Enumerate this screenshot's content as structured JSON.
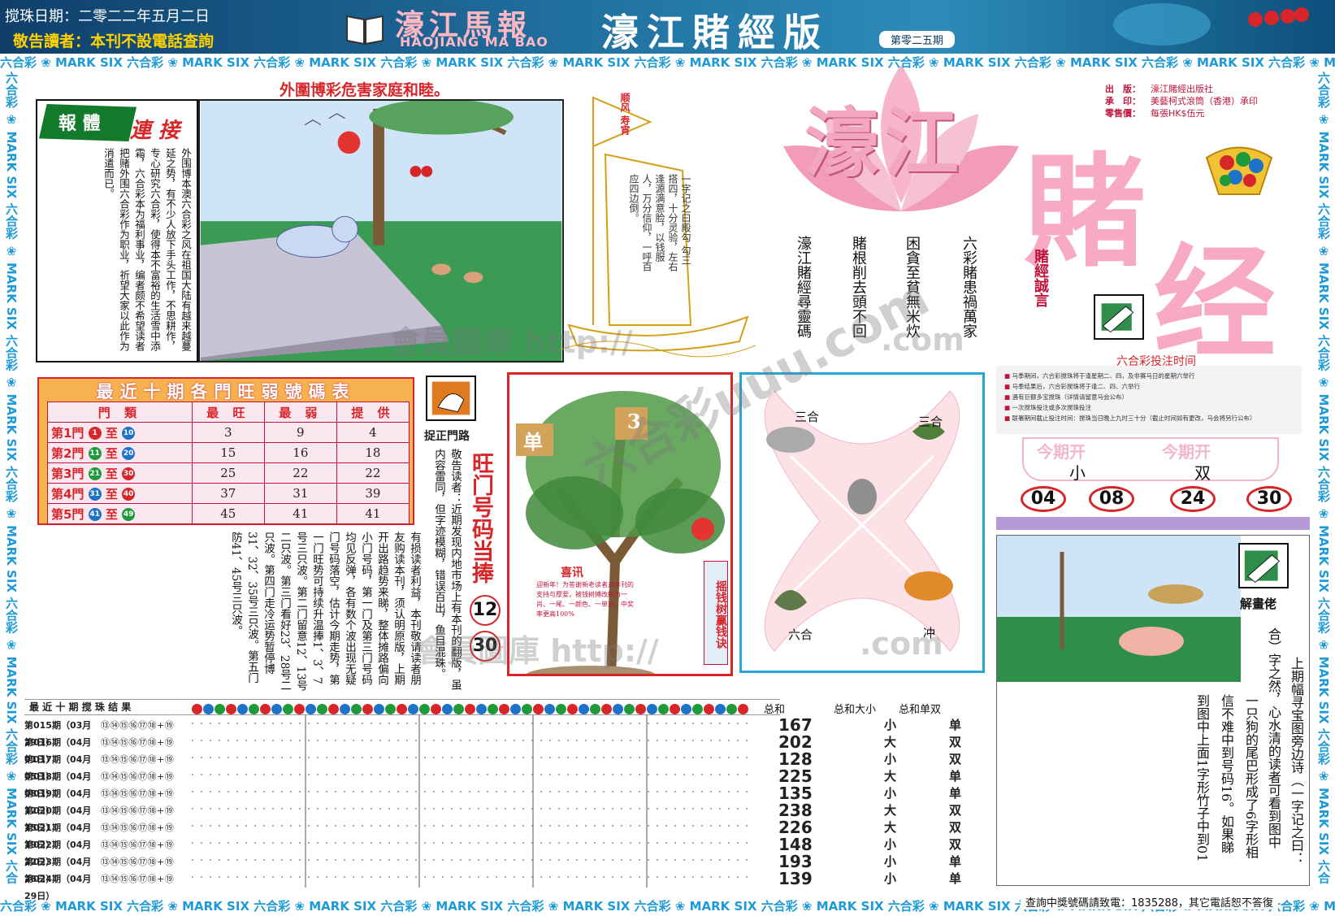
{
  "header": {
    "date": "搅珠日期：二零二二年五月二日",
    "notice": "敬告讀者：本刊不設電話查詢",
    "logo_cn": "濠江馬報",
    "logo_en": "HAOJIANG MA BAO",
    "edition": "濠江賭經版",
    "issue": "第零二五期"
  },
  "ribbon_text": "六合彩 ❀ MARK SIX 六合彩 ❀ MARK SIX 六合彩 ❀ MARK SIX 六合彩 ❀ MARK SIX 六合彩 ❀ MARK SIX 六合彩 ❀ MARK SIX 六合彩 ❀ MARK SIX 六合彩 ❀ MARK SIX 六合彩 ❀ MARK SIX 六合彩 ❀ MARK SIX 六合彩 ❀ MARK SIX 六合彩 ❀ MARK SIX",
  "article": {
    "headline": "外圍博彩危害家庭和睦。",
    "badge": "報 體",
    "badge2": "連 接",
    "body": "外围博本澳六合彩之风在祖国大陆有越来越蔓延之势，有不少人放下手头工作，不思耕作，专心研究六合彩，使得本不富裕的生活雪中添霜，六合彩本为福利事业，编者颇不希望读者把赌外围六合彩作为职业，祈望大家以此作为消遣而已。"
  },
  "boat": {
    "flag": "顺风 寿宵",
    "text": "一字记之曰殿勾 勾三搭四，十分灵验，左右逢源满意脸，以钱服人，万分信仰，一呼百应四边倒。"
  },
  "poems": [
    "六彩賭患禍萬家",
    "困貪至貧無米炊",
    "賭根削去頭不回",
    "濠江賭經尋靈碼"
  ],
  "masthead": {
    "line1": "濠江",
    "line2": "賭",
    "line3": "经",
    "motto": "賭經誠言"
  },
  "publisher": [
    {
      "k": "出　版：",
      "v": "濠江賭經出版社"
    },
    {
      "k": "承　印：",
      "v": "美藝柯式滾筒（香港）承印"
    },
    {
      "k": "零售價：",
      "v": "每張HK$伍元"
    }
  ],
  "bet_time": {
    "title": "六合彩投注时间",
    "lines": [
      "马季期间，六合彩搅珠将于逢星期二、四，及非赛马日的星期六举行",
      "马季结果后，六合彩搅珠将于逢二、四、六举行",
      "遇有巨额多宝搅珠（详情请留意马会公布）",
      "一次搅珠投注或多次搅珠投注",
      "联署期间截止投注时间：搅珠当日晚上九时三十分（截止时间如有更改，马会将另行公布）"
    ]
  },
  "this_period": {
    "label": "今期开",
    "values": [
      "小",
      "双"
    ],
    "numbers": [
      "04",
      "08",
      "24",
      "30"
    ]
  },
  "gate_table": {
    "title": "最近十期各門旺弱號碼表",
    "headers": [
      "門 類",
      "最 旺",
      "最 弱",
      "提 供"
    ],
    "rows": [
      {
        "gate": "第1門",
        "from": "1",
        "to": "10",
        "strong": "3",
        "weak": "9",
        "offer": "4",
        "c1": "#d7262a",
        "c2": "#1e73c8"
      },
      {
        "gate": "第2門",
        "from": "11",
        "to": "20",
        "strong": "15",
        "weak": "16",
        "offer": "18",
        "c1": "#1f9a3a",
        "c2": "#1e73c8"
      },
      {
        "gate": "第3門",
        "from": "21",
        "to": "30",
        "strong": "25",
        "weak": "22",
        "offer": "22",
        "c1": "#1f9a3a",
        "c2": "#d7262a"
      },
      {
        "gate": "第4門",
        "from": "31",
        "to": "40",
        "strong": "37",
        "weak": "31",
        "offer": "39",
        "c1": "#1e73c8",
        "c2": "#d7262a"
      },
      {
        "gate": "第5門",
        "from": "41",
        "to": "49",
        "strong": "45",
        "weak": "41",
        "offer": "41",
        "c1": "#1e73c8",
        "c2": "#1f9a3a"
      }
    ],
    "to_word": "至"
  },
  "zhuo": {
    "label": "捉正門路"
  },
  "notice_col1": "敬告读者：近期发现内地市场上有本刊的翻版，虽内容雷同，但字迹模糊，错误百出，鱼目混珠。",
  "notice_col2": "有损读者利益，本刊敬请读者朋友购读本刊，须认明原版，上期开出路趋势来睇，整体摊路偏向小门号码，第一门及第三门号码均见反弹，各有数个波出现无疑门号码落空，估计今期走势，第一门旺势可持续升温捧1、3、7号三只波。第二门留意12、13号二只波。第三门看好23、28号二只波。第四门走冷运势暂停博31、32、35号三只波。第五门防41、45号三只波。",
  "wang": {
    "title": "旺门号码当捧",
    "numbers": [
      "12",
      "30"
    ]
  },
  "tree": {
    "tag1": "单",
    "tag2": "3",
    "side": "摇钱树赢钱诀",
    "note_title": "喜讯",
    "note": "迎新年！为答谢新老读者对本刊的支持与厚爱，被钱树搏改版为一肖、一尾、一颜色、一单双，中奖率更高100%"
  },
  "zodiac": {
    "tl": "三合",
    "tr": "三合",
    "bl": "六合",
    "br": "冲"
  },
  "riddle": {
    "label": "解畫佬",
    "lines": [
      "上期幅寻宝图旁边诗（一字记之曰：",
      "合）字之然，心水清的读者可看到图中",
      "一只狗的尾巴形成了6字形相",
      "信不难中到号码16。如果睇",
      "到图中上面1字形竹子中到01"
    ]
  },
  "results": {
    "title": "最 近 十 期 搅 珠 结 果",
    "head_sum": "总和",
    "head_bs": "总和大小",
    "head_oe": "总和单双",
    "rows": [
      {
        "period": "第015期（03月29日）",
        "nums": "⑬⑭⑮⑯⑰⑱+⑲",
        "sum": "167",
        "bs": "小",
        "oe": "单"
      },
      {
        "period": "第016期（04月01日）",
        "nums": "⑬⑭⑮⑯⑰⑱+⑲",
        "sum": "202",
        "bs": "大",
        "oe": "双"
      },
      {
        "period": "第017期（04月05日）",
        "nums": "⑬⑭⑮⑯⑰⑱+⑲",
        "sum": "128",
        "bs": "小",
        "oe": "双"
      },
      {
        "period": "第018期（04月08日）",
        "nums": "⑬⑭⑮⑯⑰⑱+⑲",
        "sum": "225",
        "bs": "大",
        "oe": "单"
      },
      {
        "period": "第019期（04月12日）",
        "nums": "⑬⑭⑮⑯⑰⑱+⑲",
        "sum": "135",
        "bs": "小",
        "oe": "单"
      },
      {
        "period": "第020期（04月15日）",
        "nums": "⑬⑭⑮⑯⑰⑱+⑲",
        "sum": "238",
        "bs": "大",
        "oe": "双"
      },
      {
        "period": "第021期（04月19日）",
        "nums": "⑬⑭⑮⑯⑰⑱+⑲",
        "sum": "226",
        "bs": "大",
        "oe": "双"
      },
      {
        "period": "第022期（04月22日）",
        "nums": "⑬⑭⑮⑯⑰⑱+⑲",
        "sum": "148",
        "bs": "小",
        "oe": "双"
      },
      {
        "period": "第023期（04月26日）",
        "nums": "⑬⑭⑮⑯⑰⑱+⑲",
        "sum": "193",
        "bs": "小",
        "oe": "单"
      },
      {
        "period": "第024期（04月29日）",
        "nums": "⑬⑭⑮⑯⑰⑱+⑲",
        "sum": "139",
        "bs": "小",
        "oe": "单"
      }
    ]
  },
  "footer_tel": "查詢中獎號碼請致電：1835288，其它電話恕不答復",
  "watermarks": [
    "會員圖庫 http://",
    ".com",
    "六合彩uuu.com",
    "會員圖庫 http://",
    ".com"
  ]
}
